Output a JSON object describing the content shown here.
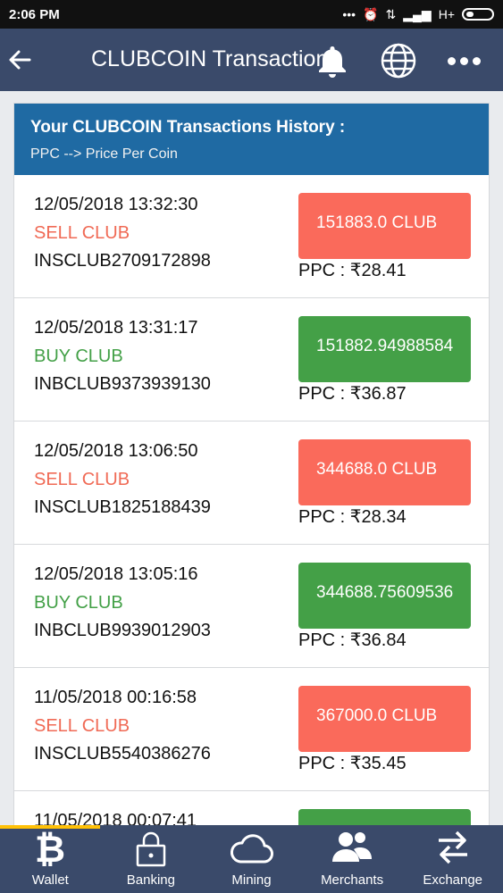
{
  "status": {
    "time": "2:06 PM",
    "signal": "H+"
  },
  "appbar": {
    "title": "CLUBCOIN Transactions"
  },
  "card": {
    "header_title": "Your CLUBCOIN Transactions History :",
    "header_subtitle": "PPC --> Price Per Coin"
  },
  "transactions": [
    {
      "datetime": "12/05/2018 13:32:30",
      "type": "SELL CLUB",
      "id": "INSCLUB2709172898",
      "amount": "151883.0 CLUB",
      "ppc": "PPC : ₹28.41"
    },
    {
      "datetime": "12/05/2018 13:31:17",
      "type": "BUY CLUB",
      "id": "INBCLUB9373939130",
      "amount": "151882.94988584",
      "ppc": "PPC : ₹36.87"
    },
    {
      "datetime": "12/05/2018 13:06:50",
      "type": "SELL CLUB",
      "id": "INSCLUB1825188439",
      "amount": "344688.0 CLUB",
      "ppc": "PPC : ₹28.34"
    },
    {
      "datetime": "12/05/2018 13:05:16",
      "type": "BUY CLUB",
      "id": "INBCLUB9939012903",
      "amount": "344688.75609536",
      "ppc": "PPC : ₹36.84"
    },
    {
      "datetime": "11/05/2018 00:16:58",
      "type": "SELL CLUB",
      "id": "INSCLUB5540386276",
      "amount": "367000.0 CLUB",
      "ppc": "PPC : ₹35.45"
    },
    {
      "datetime": "11/05/2018 00:07:41",
      "type": "",
      "id": "",
      "amount": "",
      "ppc": ""
    }
  ],
  "bottom_nav": [
    {
      "label": "Wallet",
      "icon": "bitcoin-icon"
    },
    {
      "label": "Banking",
      "icon": "lock-icon"
    },
    {
      "label": "Mining",
      "icon": "cloud-icon"
    },
    {
      "label": "Merchants",
      "icon": "people-icon"
    },
    {
      "label": "Exchange",
      "icon": "swap-arrows-icon"
    }
  ],
  "colors": {
    "appbar": "#3a4a6a",
    "header": "#1f6aa3",
    "sell": "#fa6a5b",
    "buy": "#44a047",
    "active_tab": "#ffc107"
  }
}
